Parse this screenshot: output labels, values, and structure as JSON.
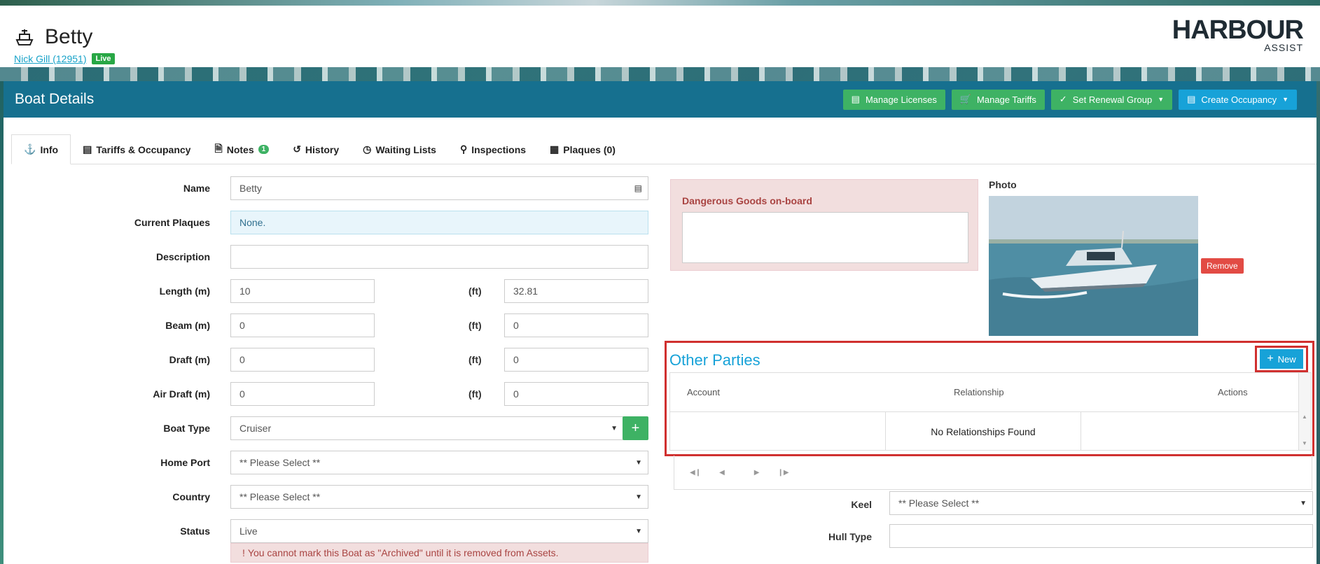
{
  "header": {
    "boat_name": "Betty",
    "owner_link": "Nick Gill (12951)",
    "owner_status": "Live",
    "logo_main": "HARBOUR",
    "logo_sub": "ASSIST"
  },
  "panel": {
    "title": "Boat Details",
    "buttons": {
      "manage_licenses": "Manage Licenses",
      "manage_tariffs": "Manage Tariffs",
      "set_renewal_group": "Set Renewal Group",
      "create_occupancy": "Create Occupancy"
    }
  },
  "tabs": [
    {
      "label": "Info",
      "icon": "boat-icon"
    },
    {
      "label": "Tariffs & Occupancy",
      "icon": "bed-icon"
    },
    {
      "label": "Notes",
      "icon": "document-icon",
      "count": "1"
    },
    {
      "label": "History",
      "icon": "history-icon"
    },
    {
      "label": "Waiting Lists",
      "icon": "clock-icon"
    },
    {
      "label": "Inspections",
      "icon": "search-icon"
    },
    {
      "label": "Plaques (0)",
      "icon": "plaque-icon"
    }
  ],
  "form": {
    "name_label": "Name",
    "name_value": "Betty",
    "plaques_label": "Current Plaques",
    "plaques_value": "None.",
    "description_label": "Description",
    "description_value": "",
    "length_label": "Length (m)",
    "length_m": "10",
    "length_ft": "32.81",
    "beam_label": "Beam (m)",
    "beam_m": "0",
    "beam_ft": "0",
    "draft_label": "Draft (m)",
    "draft_m": "0",
    "draft_ft": "0",
    "airdraft_label": "Air Draft (m)",
    "airdraft_m": "0",
    "airdraft_ft": "0",
    "ft_label": "(ft)",
    "boat_type_label": "Boat Type",
    "boat_type_value": "Cruiser",
    "home_port_label": "Home Port",
    "home_port_value": "** Please Select **",
    "country_label": "Country",
    "country_value": "** Please Select **",
    "status_label": "Status",
    "status_value": "Live",
    "status_warning": "You cannot mark this Boat as \"Archived\" until it is removed from Assets."
  },
  "dangerous_goods": {
    "label": "Dangerous Goods on-board",
    "value": ""
  },
  "photo": {
    "label": "Photo",
    "remove": "Remove"
  },
  "other_parties": {
    "title": "Other Parties",
    "new_button": "New",
    "columns": [
      "Account",
      "Relationship",
      "Actions"
    ],
    "empty_text": "No Relationships Found"
  },
  "right_form": {
    "keel_label": "Keel",
    "keel_value": "** Please Select **",
    "hull_label": "Hull Type",
    "hull_value": ""
  },
  "colors": {
    "accent": "#17a2d8",
    "header_bar": "#16708f",
    "green": "#3eb264",
    "highlight": "#d0302f"
  }
}
